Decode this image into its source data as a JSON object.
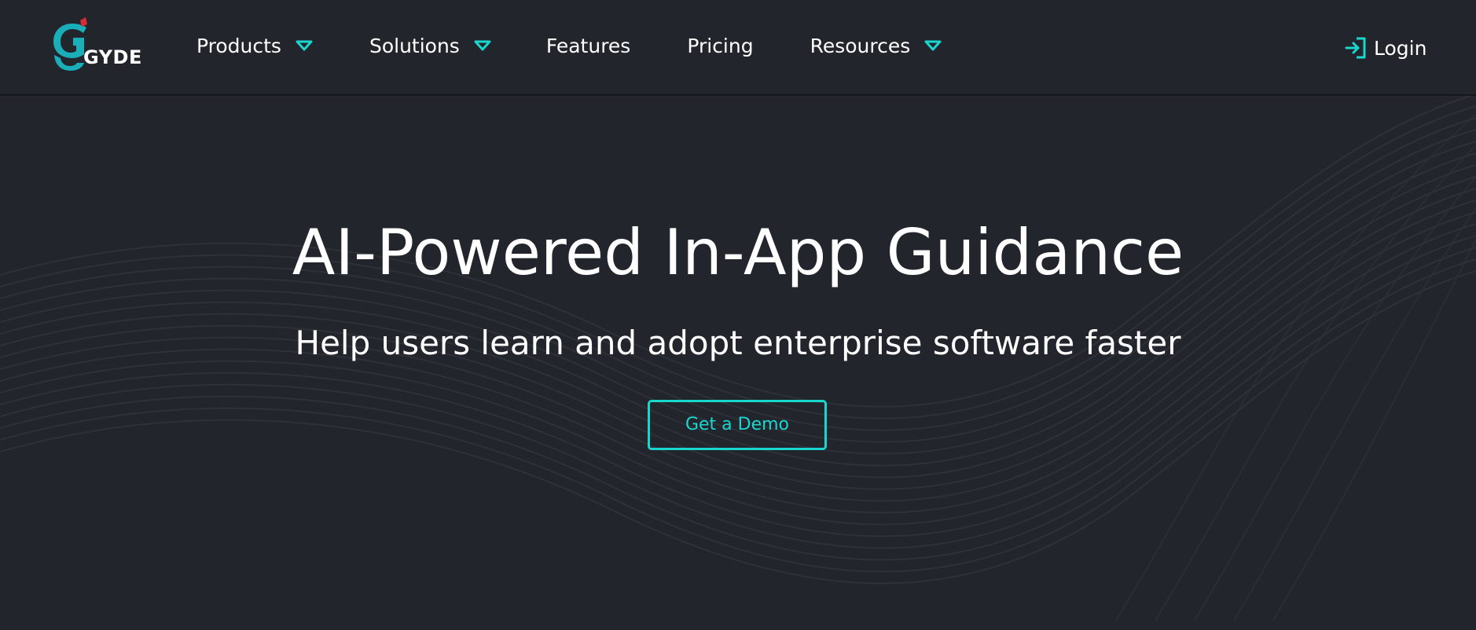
{
  "brand": {
    "name": "GYDE",
    "accent_color": "#19d6cf",
    "logo_icon": "g-logo-icon"
  },
  "nav": {
    "items": [
      {
        "label": "Products",
        "has_dropdown": true
      },
      {
        "label": "Solutions",
        "has_dropdown": true
      },
      {
        "label": "Features",
        "has_dropdown": false
      },
      {
        "label": "Pricing",
        "has_dropdown": false
      },
      {
        "label": "Resources",
        "has_dropdown": true
      }
    ],
    "dropdown_icon": "caret-down-icon"
  },
  "header": {
    "login_label": "Login",
    "login_icon": "login-icon"
  },
  "hero": {
    "title": "AI-Powered In-App Guidance",
    "subtitle": "Help users learn and adopt enterprise software faster",
    "cta_label": "Get a Demo"
  },
  "colors": {
    "background": "#22252c",
    "text": "#ffffff",
    "accent": "#19d6cf",
    "line": "#3a3d44"
  }
}
